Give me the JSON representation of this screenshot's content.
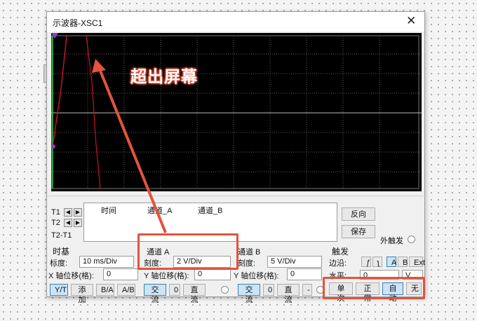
{
  "window": {
    "title": "示波器-XSC1",
    "close": "✕"
  },
  "annotation": {
    "text": "超出屏幕"
  },
  "readout": {
    "rows": [
      "T1",
      "T2",
      "T2-T1"
    ],
    "headers": {
      "time": "时间",
      "chA": "通道_A",
      "chB": "通道_B"
    },
    "reverse": "反向",
    "save": "保存",
    "ext_trigger": "外触发"
  },
  "timebase": {
    "title": "时基",
    "scale_label": "标度:",
    "scale_value": "10 ms/Div",
    "xpos_label": "X 轴位移(格):",
    "xpos_value": "0",
    "buttons": [
      "Y/T",
      "添加",
      "B/A",
      "A/B"
    ]
  },
  "channel_a": {
    "title": "通道 A",
    "scale_label": "刻度:",
    "scale_value": "2  V/Div",
    "ypos_label": "Y 轴位移(格):",
    "ypos_value": "0",
    "coupling": [
      "交流",
      "0",
      "直流"
    ]
  },
  "channel_b": {
    "title": "通道 B",
    "scale_label": "刻度:",
    "scale_value": "5  V/Div",
    "ypos_label": "Y 轴位移(格):",
    "ypos_value": "0",
    "coupling": [
      "交流",
      "0",
      "直流",
      "-"
    ]
  },
  "trigger": {
    "title": "触发",
    "edge_label": "边沿:",
    "edge_buttons": [
      "ƒ",
      "ʅ",
      "A",
      "B",
      "Ext"
    ],
    "level_label": "水平:",
    "level_value": "0",
    "level_unit": "V",
    "modes": [
      "单次",
      "正常",
      "自动",
      "无"
    ]
  },
  "colors": {
    "annotation": "#e2543c",
    "trace_a": "#c8102e",
    "trace_axis": "#1fc23a",
    "marker": "#a033c8",
    "screen": "#000000"
  }
}
